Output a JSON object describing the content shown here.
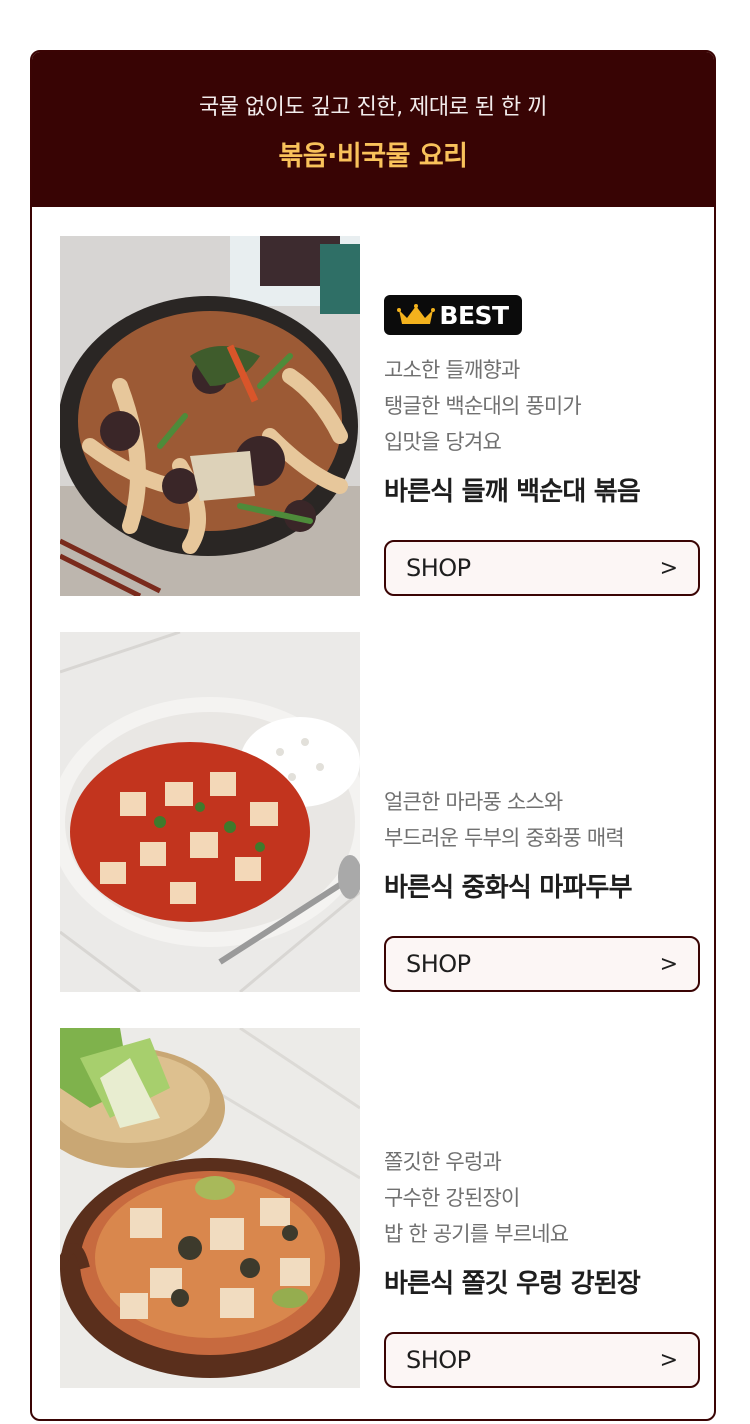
{
  "header": {
    "subtitle": "국물 없이도 깊고 진한, 제대로 된 한 끼",
    "title": "볶음·비국물 요리"
  },
  "colors": {
    "header_bg": "#380404",
    "title_accent": "#f9c25b",
    "border": "#3a0404",
    "button_bg": "#fcf6f5"
  },
  "products": [
    {
      "badge": {
        "icon": "crown-icon",
        "label": "BEST"
      },
      "description": [
        "고소한 들깨향과",
        "탱글한 백순대의 풍미가",
        "입맛을 당겨요"
      ],
      "name": "바른식 들깨 백순대 볶음",
      "button": {
        "label": "SHOP",
        "icon": "chevron-right-icon",
        "glyph": ">"
      }
    },
    {
      "description": [
        "얼큰한 마라풍 소스와",
        "부드러운 두부의 중화풍 매력"
      ],
      "name": "바른식 중화식 마파두부",
      "button": {
        "label": "SHOP",
        "icon": "chevron-right-icon",
        "glyph": ">"
      }
    },
    {
      "description": [
        "쫄깃한 우렁과",
        "구수한 강된장이",
        "밥 한 공기를 부르네요"
      ],
      "name": "바른식 쫄깃 우렁 강된장",
      "button": {
        "label": "SHOP",
        "icon": "chevron-right-icon",
        "glyph": ">"
      }
    }
  ]
}
